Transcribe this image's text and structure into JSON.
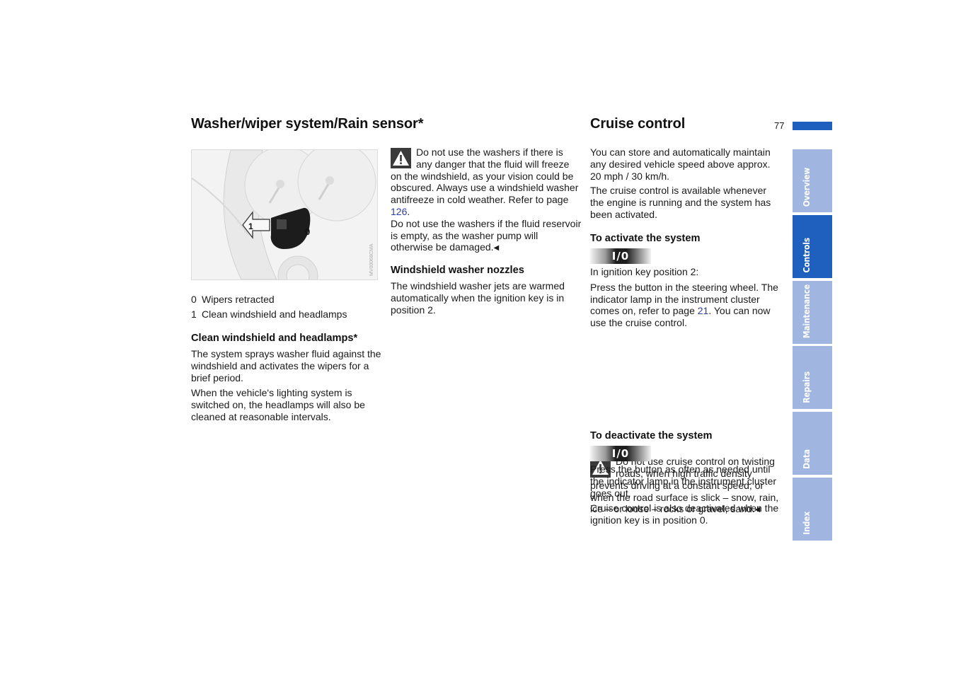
{
  "page_number": "77",
  "accent_color": "#1f5fbd",
  "tab_color": "#a0b5e0",
  "left": {
    "title": "Washer/wiper system/Rain sensor*",
    "figure": {
      "description": "Steering column stalk with washer control",
      "label_1": "1",
      "label_0": "0",
      "code": "MV00068CMA"
    },
    "legend": [
      {
        "num": "0",
        "text": "Wipers retracted"
      },
      {
        "num": "1",
        "text": "Clean windshield and headlamps"
      }
    ],
    "section1": {
      "heading": "Clean windshield and headlamps*",
      "paragraphs": [
        "The system sprays washer fluid against the windshield and activates the wipers for a brief period.",
        "When the vehicle's lighting system is switched on, the headlamps will also be cleaned at reasonable intervals."
      ]
    }
  },
  "middle": {
    "warning": {
      "icon": "warning-triangle-icon",
      "text_before_link": "Do not use the washers if there is any danger that the fluid will freeze on the windshield, as your vision could be obscured. Always use a windshield washer antifreeze in cold weather. Refer to page ",
      "link": "126",
      "text_after_link": ".",
      "text2": "Do not use the washers if the fluid reservoir is empty, as the washer pump will otherwise be damaged.",
      "end_mark": "◀"
    },
    "section2": {
      "heading": "Windshield washer nozzles",
      "paragraph": "The windshield washer jets are warmed automatically when the ignition key is in position 2."
    }
  },
  "right": {
    "title": "Cruise control",
    "intro": [
      "You can store and automatically maintain any desired vehicle speed above approx. 20 mph / 30 km/h.",
      "The cruise control is available whenever the engine is running and the system has been activated."
    ],
    "activate": {
      "heading": "To activate the system",
      "button_label": "I/0",
      "line1": "In ignition key position 2:",
      "text_before_link": "Press the button in the steering wheel. The indicator lamp in the instrument cluster comes on, refer to page ",
      "link": "21",
      "text_after_link": ". You can now use the cruise control."
    },
    "warning": {
      "icon": "warning-triangle-icon",
      "text": "Do not use cruise control on twisting roads, when high traffic density prevents driving at a constant speed, or when the road surface is slick – snow, rain, ice – or loose – rocks or gravel, sand.",
      "end_mark": "◀"
    },
    "deactivate": {
      "heading": "To deactivate the system",
      "button_label": "I/0",
      "paragraphs": [
        "Press the button as often as needed until the indicator lamp in the instrument cluster goes out.",
        "Cruise control is also deactivated when the ignition key is in position 0."
      ]
    }
  },
  "side_tabs": [
    {
      "label": "Overview",
      "active": false
    },
    {
      "label": "Controls",
      "active": true
    },
    {
      "label": "Maintenance",
      "active": false
    },
    {
      "label": "Repairs",
      "active": false
    },
    {
      "label": "Data",
      "active": false
    },
    {
      "label": "Index",
      "active": false
    }
  ]
}
